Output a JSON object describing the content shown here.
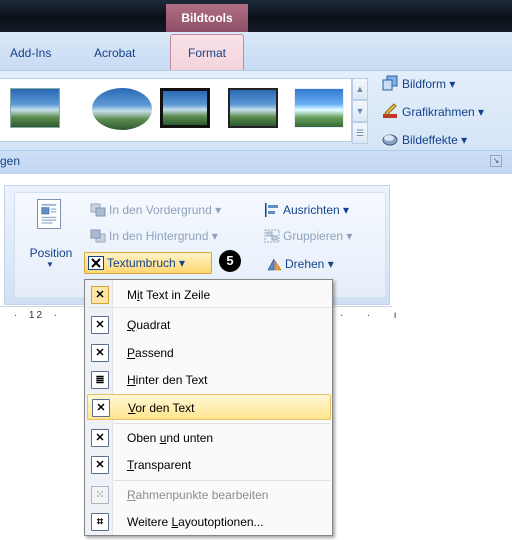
{
  "contextual_tab": {
    "label": "Bildtools"
  },
  "tabs": [
    {
      "label": "Add-Ins"
    },
    {
      "label": "Acrobat"
    },
    {
      "label": "Format",
      "selected": true
    }
  ],
  "picture_styles_group": {
    "label": "gen",
    "buttons": [
      {
        "label": "Bildform",
        "icon": "picture-shape-icon"
      },
      {
        "label": "Grafikrahmen",
        "icon": "picture-border-icon"
      },
      {
        "label": "Bildeffekte",
        "icon": "picture-effects-icon"
      }
    ]
  },
  "arrange_group": {
    "position_label": "Position",
    "bring_forward": "In den Vordergrund",
    "send_backward": "In den Hintergrund",
    "align": "Ausrichten",
    "group": "Gruppieren",
    "text_wrap": "Textumbruch",
    "rotate": "Drehen"
  },
  "callout_number": "5",
  "ruler": {
    "left_text": "·  12  ·",
    "right_text": "·  ·  ı"
  },
  "wrap_menu": {
    "items": [
      {
        "label": "Mit Text in Zeile",
        "underline_index": 1,
        "state": "checked"
      },
      {
        "label": "Quadrat",
        "underline_index": 0
      },
      {
        "label": "Passend",
        "underline_index": 0
      },
      {
        "label": "Hinter den Text",
        "underline_index": 0
      },
      {
        "label": "Vor den Text",
        "underline_index": 0,
        "state": "hover"
      },
      {
        "label": "Oben und unten",
        "underline_index": 5
      },
      {
        "label": "Transparent",
        "underline_index": 0
      },
      {
        "label": "Rahmenpunkte bearbeiten",
        "underline_index": 0,
        "state": "disabled"
      },
      {
        "label": "Weitere Layoutoptionen...",
        "underline_index": 8
      }
    ]
  },
  "colors": {
    "ribbon_text": "#15428b",
    "menu_hover": "#ffe58f",
    "format_tab": "#f3d3dc"
  }
}
